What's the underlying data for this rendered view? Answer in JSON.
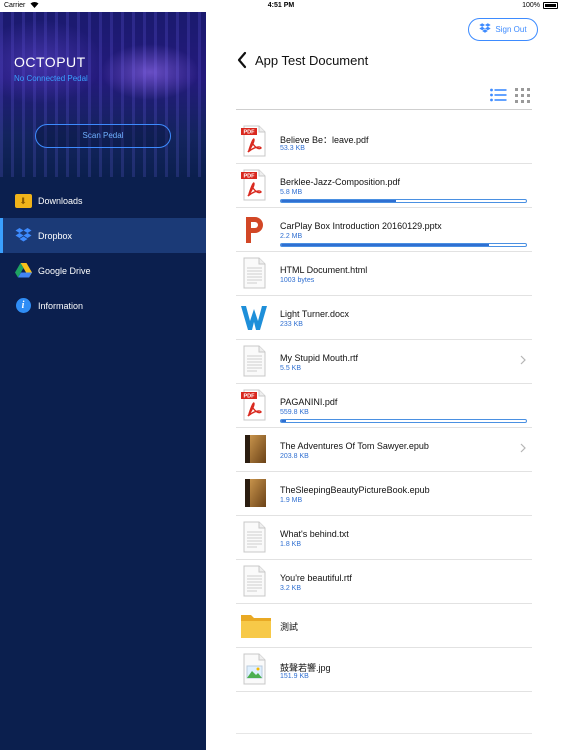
{
  "status_bar": {
    "carrier": "Carrier",
    "time": "4:51 PM",
    "battery": "100%"
  },
  "sidebar": {
    "app_title": "OCTOPUT",
    "pedal_status": "No Connected Pedal",
    "scan_button": "Scan Pedal",
    "items": [
      {
        "label": "Downloads",
        "icon": "downloads-folder-icon",
        "active": false
      },
      {
        "label": "Dropbox",
        "icon": "dropbox-icon",
        "active": true
      },
      {
        "label": "Google Drive",
        "icon": "google-drive-icon",
        "active": false
      },
      {
        "label": "Information",
        "icon": "info-icon",
        "active": false
      }
    ]
  },
  "header": {
    "sign_out": "Sign Out",
    "title": "App Test Document",
    "view_mode": "list"
  },
  "colors": {
    "accent": "#3d8bff",
    "sidebar_bg": "#0b1f4e",
    "size_text": "#2f6fd1"
  },
  "files": [
    {
      "name": "Believe Be：leave.pdf",
      "size": "53.3 KB",
      "icon": "pdf-icon"
    },
    {
      "name": "Berklee-Jazz-Composition.pdf",
      "size": "5.8 MB",
      "icon": "pdf-icon",
      "progress": 0.47
    },
    {
      "name": "CarPlay Box Introduction 20160129.pptx",
      "size": "2.2 MB",
      "icon": "powerpoint-icon",
      "progress": 0.85
    },
    {
      "name": "HTML Document.html",
      "size": "1003 bytes",
      "icon": "document-icon"
    },
    {
      "name": "Light Turner.docx",
      "size": "233 KB",
      "icon": "word-icon"
    },
    {
      "name": "My Stupid Mouth.rtf",
      "size": "5.5 KB",
      "icon": "document-icon",
      "chevron": true
    },
    {
      "name": "PAGANINI.pdf",
      "size": "559.8 KB",
      "icon": "pdf-icon",
      "progress": 0.02
    },
    {
      "name": "The Adventures Of Tom Sawyer.epub",
      "size": "203.8 KB",
      "icon": "book-icon",
      "chevron": true
    },
    {
      "name": "TheSleepingBeautyPictureBook.epub",
      "size": "1.9 MB",
      "icon": "book-icon"
    },
    {
      "name": "What's behind.txt",
      "size": "1.8 KB",
      "icon": "document-icon"
    },
    {
      "name": "You're beautiful.rtf",
      "size": "3.2 KB",
      "icon": "document-icon"
    },
    {
      "name": "測試",
      "size": "",
      "icon": "folder-icon"
    },
    {
      "name": "鼓聲若響.jpg",
      "size": "151.9 KB",
      "icon": "image-file-icon"
    }
  ]
}
